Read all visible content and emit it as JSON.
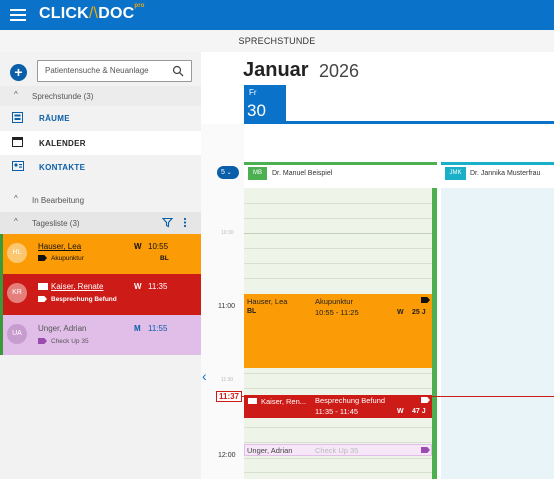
{
  "app": {
    "logo_text": "CLICK",
    "logo_mid": "DOC",
    "logo_sup": "pro",
    "section_title": "SPRECHSTUNDE"
  },
  "sidebar": {
    "search_placeholder": "Patientensuche & Neuanlage",
    "section_sprechstunde": "Sprechstunde (3)",
    "nav": [
      {
        "label": "RÄUME",
        "icon": "rooms-icon"
      },
      {
        "label": "KALENDER",
        "icon": "calendar-icon"
      },
      {
        "label": "KONTAKTE",
        "icon": "contacts-icon"
      }
    ],
    "section_bearbeitung": "In Bearbeitung",
    "section_tagesliste": "Tagesliste (3)",
    "cards": [
      {
        "initials": "HL",
        "name": "Hauser, Lea",
        "badge": "W",
        "time": "10:55",
        "desc": "Akupunktur",
        "code": "BL",
        "color": "#fb9b05"
      },
      {
        "initials": "KR",
        "name": "Kaiser, Renate",
        "badge": "W",
        "time": "11:35",
        "desc": "Besprechung Befund",
        "code": "",
        "color": "#cd1b17"
      },
      {
        "initials": "UA",
        "name": "Unger, Adrian",
        "badge": "M",
        "time": "11:55",
        "desc": "Check Up 35",
        "code": "",
        "color": "#e1bee8"
      }
    ]
  },
  "calendar": {
    "month": "Januar",
    "year": "2026",
    "day_abbr": "Fr",
    "day_num": "30",
    "days_dropdown": "5",
    "columns": [
      {
        "initials": "MB",
        "name": "Dr. Manuel Beispiel",
        "color": "#4caf50"
      },
      {
        "initials": "JMK",
        "name": "Dr. Jannika Musterfrau",
        "color": "#1ab0c8"
      }
    ],
    "times": {
      "t1030": "10:30",
      "t1100": "11:00",
      "t1130": "11:30",
      "t1137": "11:37",
      "t1200": "12:00"
    },
    "appointments": [
      {
        "name": "Hauser, Lea",
        "code": "BL",
        "type": "Akupunktur",
        "range": "10:55 - 11:25",
        "badge": "W",
        "age": "25 J"
      },
      {
        "name": "Kaiser, Ren...",
        "type": "Besprechung Befund",
        "range": "11:35 - 11:45",
        "badge": "W",
        "age": "47 J"
      },
      {
        "name": "Unger, Adrian",
        "type": "Check Up 35"
      }
    ]
  }
}
